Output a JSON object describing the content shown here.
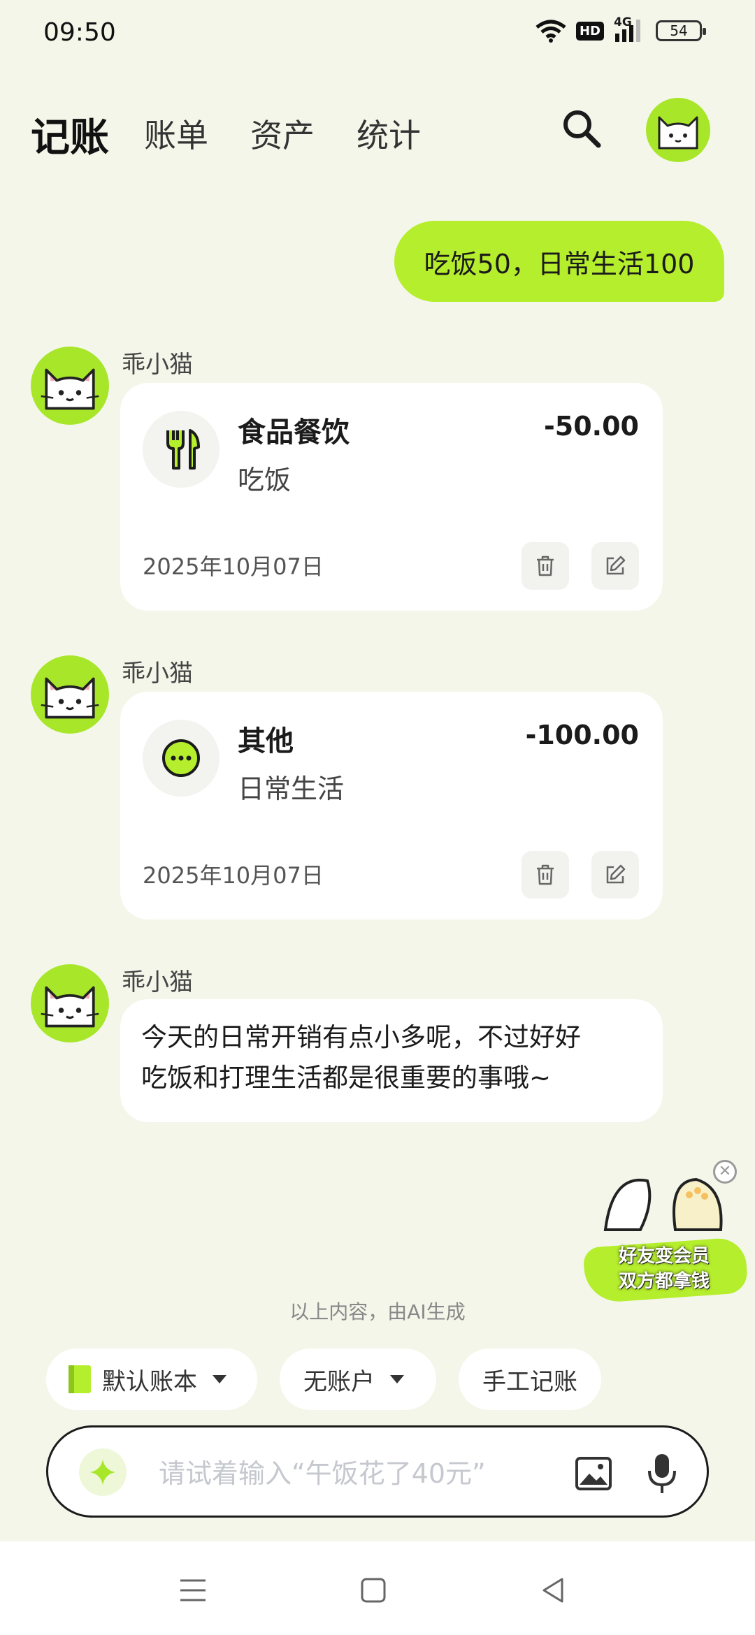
{
  "status_bar": {
    "time": "09:50",
    "hd": "HD",
    "network": "4G",
    "battery": "54",
    "battery_level": 0.54
  },
  "nav": {
    "tabs": [
      {
        "label": "记账",
        "active": true
      },
      {
        "label": "账单",
        "active": false
      },
      {
        "label": "资产",
        "active": false
      },
      {
        "label": "统计",
        "active": false
      }
    ]
  },
  "chat": {
    "user_message": "吃饭50，日常生活100",
    "bot_name": "乖小猫",
    "entries": [
      {
        "category": "食品餐饮",
        "note": "吃饭",
        "amount": "-50.00",
        "date": "2025年10月07日",
        "icon": "fork-knife-icon"
      },
      {
        "category": "其他",
        "note": "日常生活",
        "amount": "-100.00",
        "date": "2025年10月07日",
        "icon": "more-dots-icon"
      }
    ],
    "reply_line1": "今天的日常开销有点小多呢，不过好好",
    "reply_line2": "吃饭和打理生活都是很重要的事哦~"
  },
  "promo": {
    "line1": "好友变会员",
    "line2": "双方都拿钱"
  },
  "ai_note": "以上内容，由AI生成",
  "chips": {
    "book": "默认账本",
    "account": "无账户",
    "manual": "手工记账"
  },
  "input": {
    "placeholder": "请试着输入“午饭花了40元”"
  },
  "colors": {
    "accent": "#b5ee2c",
    "background": "#f4f6ea",
    "text": "#1b1b1b"
  }
}
